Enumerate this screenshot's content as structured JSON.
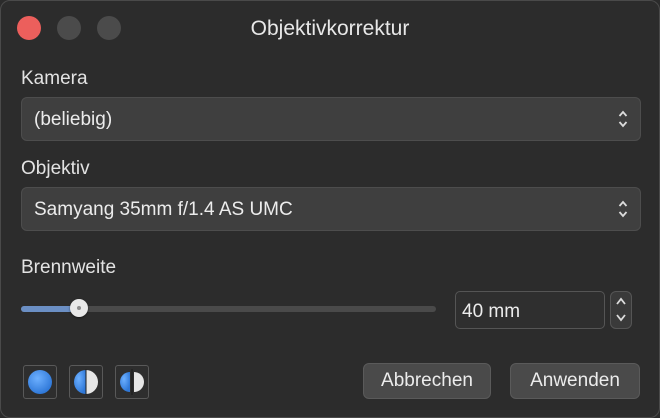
{
  "window": {
    "title": "Objektivkorrektur"
  },
  "camera": {
    "label": "Kamera",
    "value": "(beliebig)"
  },
  "lens": {
    "label": "Objektiv",
    "value": "Samyang 35mm f/1.4 AS UMC"
  },
  "focal_length": {
    "label": "Brennweite",
    "value": "40 mm",
    "slider_fraction": 0.14
  },
  "mode_buttons": [
    {
      "icon": "full-circle-icon"
    },
    {
      "icon": "split-circle-icon"
    },
    {
      "icon": "compare-circles-icon"
    }
  ],
  "buttons": {
    "cancel": "Abbrechen",
    "apply": "Anwenden"
  },
  "colors": {
    "close": "#ec5f5c",
    "accent": "#6b8fc4",
    "mode_blue": "#4a90e2"
  }
}
